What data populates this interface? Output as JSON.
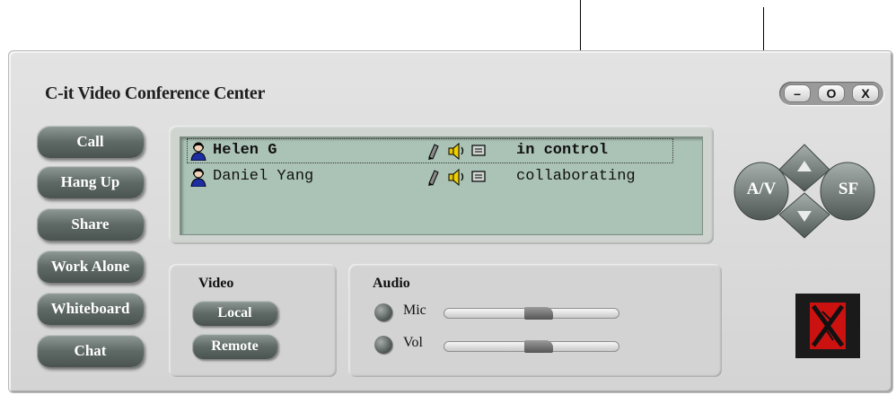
{
  "window": {
    "title": "C-it Video Conference Center"
  },
  "window_controls": {
    "minimize": "–",
    "restore": "O",
    "close": "X"
  },
  "sidebar": {
    "buttons": [
      "Call",
      "Hang Up",
      "Share",
      "Work Alone",
      "Whiteboard",
      "Chat"
    ]
  },
  "participants": [
    {
      "name": "Helen G",
      "status": "in control",
      "selected": true,
      "icons": [
        "pen-icon",
        "speaker-icon",
        "screen-icon"
      ]
    },
    {
      "name": "Daniel Yang",
      "status": "collaborating",
      "selected": false,
      "icons": [
        "pen-icon",
        "speaker-icon",
        "screen-icon"
      ]
    }
  ],
  "video": {
    "title": "Video",
    "local_label": "Local",
    "remote_label": "Remote"
  },
  "audio": {
    "title": "Audio",
    "mic_label": "Mic",
    "vol_label": "Vol",
    "mic_level": 0.45,
    "vol_level": 0.45
  },
  "navpad": {
    "left_label": "A/V",
    "right_label": "SF",
    "up_icon": "arrow-up-icon",
    "down_icon": "arrow-down-icon"
  },
  "logo": {
    "icon": "x-logo-icon",
    "color": "#cc0000"
  }
}
